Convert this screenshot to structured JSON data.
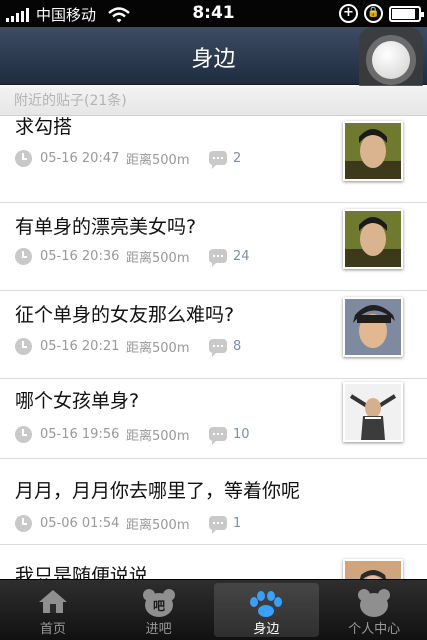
{
  "status_bar": {
    "carrier": "中国移动",
    "time": "8:41",
    "battery_level": 0.9
  },
  "header": {
    "title": "身边"
  },
  "section": {
    "label": "附近的贴子(21条)"
  },
  "posts": [
    {
      "title": "求勾搭",
      "date": "05-16 20:47",
      "distance": "距离500m",
      "comments": "2",
      "thumb": "young-man-photo"
    },
    {
      "title": "有单身的漂亮美女吗?",
      "date": "05-16 20:36",
      "distance": "距离500m",
      "comments": "24",
      "thumb": "young-man-photo"
    },
    {
      "title": "征个单身的女友那么难吗?",
      "date": "05-16 20:21",
      "distance": "距离500m",
      "comments": "8",
      "thumb": "man-with-cap-photo"
    },
    {
      "title": "哪个女孩单身?",
      "date": "05-16 19:56",
      "distance": "距离500m",
      "comments": "10",
      "thumb": "person-pose-photo"
    },
    {
      "title": "月月，月月你去哪里了，等着你呢",
      "date": "05-06 01:54",
      "distance": "距离500m",
      "comments": "1",
      "thumb": ""
    },
    {
      "title": "我只是随便说说",
      "date": "",
      "distance": "",
      "comments": "",
      "thumb": "person-photo"
    }
  ],
  "tabs": [
    {
      "label": "首页",
      "icon": "home-icon"
    },
    {
      "label": "进吧",
      "icon": "bar-bear-icon"
    },
    {
      "label": "身边",
      "icon": "paw-icon",
      "active": true
    },
    {
      "label": "个人中心",
      "icon": "bear-head-icon"
    }
  ],
  "colors": {
    "nav_bar": "#2b3950",
    "comment_count": "#7b8fb0",
    "active_tab_icon": "#3aa0ff"
  }
}
